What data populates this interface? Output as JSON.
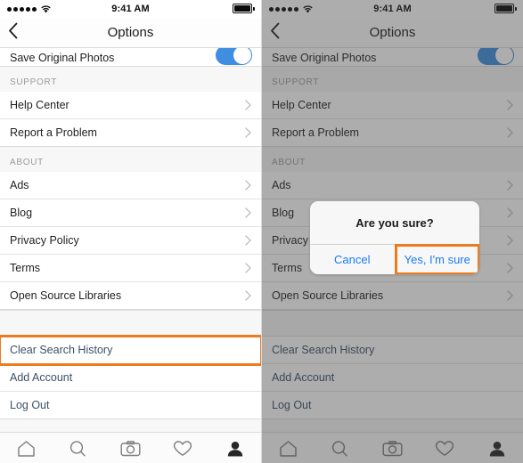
{
  "status_bar": {
    "signal_dots": 5,
    "wifi_icon": "wifi-icon",
    "time": "9:41 AM",
    "battery_icon": "battery-full-icon"
  },
  "nav": {
    "back_icon": "chevron-left-icon",
    "title": "Options"
  },
  "list": {
    "partial_row": {
      "label": "Save Original Photos",
      "toggle_state": "on",
      "toggle_color": "#3f8ee0"
    },
    "sections": [
      {
        "header": "SUPPORT",
        "rows": [
          {
            "label": "Help Center",
            "accessory": "chevron-right-icon"
          },
          {
            "label": "Report a Problem",
            "accessory": "chevron-right-icon"
          }
        ]
      },
      {
        "header": "ABOUT",
        "rows": [
          {
            "label": "Ads",
            "accessory": "chevron-right-icon"
          },
          {
            "label": "Blog",
            "accessory": "chevron-right-icon"
          },
          {
            "label": "Privacy Policy",
            "accessory": "chevron-right-icon"
          },
          {
            "label": "Terms",
            "accessory": "chevron-right-icon"
          },
          {
            "label": "Open Source Libraries",
            "accessory": "chevron-right-icon"
          }
        ]
      },
      {
        "header": "",
        "rows": [
          {
            "label": "Clear Search History",
            "accessory": "",
            "highlighted": true
          },
          {
            "label": "Add Account",
            "accessory": ""
          },
          {
            "label": "Log Out",
            "accessory": ""
          }
        ]
      }
    ]
  },
  "tab_bar": {
    "tabs": [
      {
        "icon": "home-icon",
        "active": false
      },
      {
        "icon": "search-icon",
        "active": false
      },
      {
        "icon": "camera-icon",
        "active": false
      },
      {
        "icon": "heart-icon",
        "active": false
      },
      {
        "icon": "profile-icon",
        "active": true
      }
    ]
  },
  "dialog": {
    "title": "Are you sure?",
    "cancel_label": "Cancel",
    "confirm_label": "Yes, I'm sure",
    "confirm_highlighted": true
  },
  "colors": {
    "highlight": "#ee7c1e",
    "action_text": "#3c5068",
    "dialog_link": "#1a7cf0",
    "toggle_on": "#3f8ee0",
    "section_header": "#9b9b9b"
  }
}
